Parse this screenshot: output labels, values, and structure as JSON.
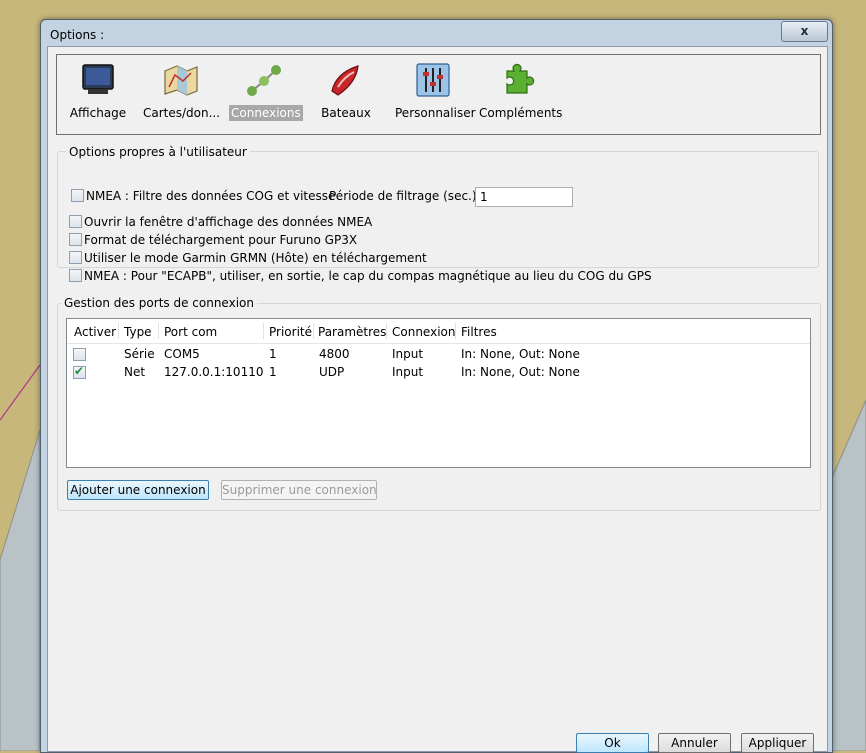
{
  "window": {
    "title": "Options :",
    "close_symbol": "x"
  },
  "toolbar": {
    "items": [
      {
        "label": "Affichage",
        "icon": "monitor-icon"
      },
      {
        "label": "Cartes/don...",
        "icon": "map-icon"
      },
      {
        "label": "Connexions",
        "icon": "connections-icon",
        "selected": true
      },
      {
        "label": "Bateaux",
        "icon": "boat-icon"
      },
      {
        "label": "Personnaliser",
        "icon": "sliders-icon"
      },
      {
        "label": "Compléments",
        "icon": "puzzle-icon"
      }
    ]
  },
  "user_options": {
    "title": "Options propres à l'utilisateur",
    "nmea_filter_label": "NMEA : Filtre des données COG et vitesse",
    "filter_period_label": "Période de filtrage (sec.)",
    "filter_period_value": "1",
    "nmea_window_label": "Ouvrir la fenêtre d'affichage des données NMEA",
    "furuno_label": "Format de téléchargement pour Furuno GP3X",
    "garmin_label": "Utiliser le mode Garmin GRMN (Hôte) en téléchargement",
    "ecapb_label": "NMEA : Pour \"ECAPB\", utiliser, en sortie, le cap du compas magnétique  au lieu du COG du GPS"
  },
  "ports": {
    "title": "Gestion des ports de connexion",
    "columns": [
      "Activer",
      "Type",
      "Port com",
      "Priorité",
      "Paramètres",
      "Connexion",
      "Filtres"
    ],
    "rows": [
      {
        "enabled": false,
        "type": "Série",
        "port": "COM5",
        "priority": "1",
        "params": "4800",
        "connection": "Input",
        "filters": "In: None, Out: None"
      },
      {
        "enabled": true,
        "type": "Net",
        "port": "127.0.0.1:10110",
        "priority": "1",
        "params": "UDP",
        "connection": "Input",
        "filters": "In: None, Out: None"
      }
    ],
    "add_label": "Ajouter une connexion",
    "remove_label": "Supprimer une connexion"
  },
  "footer": {
    "ok_label": "Ok",
    "cancel_label": "Annuler",
    "apply_label": "Appliquer"
  },
  "colors": {
    "chart_land": "#c7b77b",
    "chart_water": "#b8c2c6",
    "window_frame": "#c4d3e2",
    "selected_tab": "#a8a8a8",
    "check_green": "#2a8a4a"
  }
}
